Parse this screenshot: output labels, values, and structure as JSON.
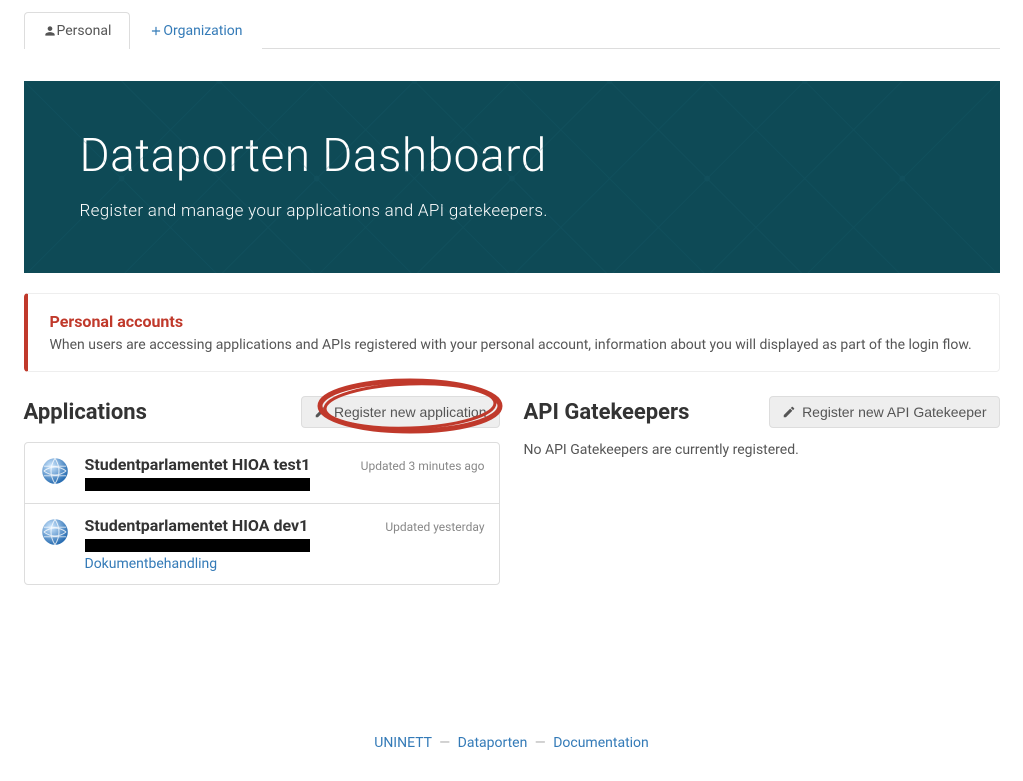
{
  "tabs": {
    "personal": "Personal",
    "organization": "Organization"
  },
  "hero": {
    "title": "Dataporten Dashboard",
    "subtitle": "Register and manage your applications and API gatekeepers."
  },
  "notice": {
    "title": "Personal accounts",
    "text": "When users are accessing applications and APIs registered with your personal account, information about you will displayed as part of the login flow."
  },
  "applications": {
    "heading": "Applications",
    "register_label": "Register new application",
    "items": [
      {
        "title": "Studentparlamentet HIOA test1",
        "updated": "Updated 3 minutes ago",
        "tag": ""
      },
      {
        "title": "Studentparlamentet HIOA dev1",
        "updated": "Updated yesterday",
        "tag": "Dokumentbehandling"
      }
    ]
  },
  "gatekeepers": {
    "heading": "API Gatekeepers",
    "register_label": "Register new API Gatekeeper",
    "empty": "No API Gatekeepers are currently registered."
  },
  "footer": {
    "link1": "UNINETT",
    "link2": "Dataporten",
    "link3": "Documentation",
    "sep": "—"
  }
}
